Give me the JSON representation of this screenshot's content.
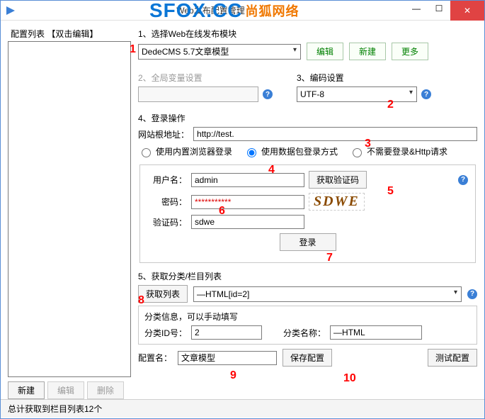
{
  "window": {
    "title": "Web发布配置管理"
  },
  "watermark": {
    "text1": "SFOX.CC",
    "text2": "尚狐网络"
  },
  "left": {
    "list_label": "配置列表 【双击编辑】",
    "new_btn": "新建",
    "edit_btn": "编辑",
    "delete_btn": "删除"
  },
  "sec1": {
    "title": "1、选择Web在线发布模块",
    "module_selected": "DedeCMS 5.7文章模型",
    "edit": "编辑",
    "new": "新建",
    "more": "更多"
  },
  "sec2": {
    "title": "2、全局变量设置"
  },
  "sec3": {
    "title": "3、编码设置",
    "encoding_selected": "UTF-8"
  },
  "sec4": {
    "title": "4、登录操作",
    "root_label": "网站根地址：",
    "root_value": "http://test.",
    "radio1": "使用内置浏览器登录",
    "radio2": "使用数据包登录方式",
    "radio3": "不需要登录&Http请求",
    "user_label": "用户名：",
    "user_value": "admin",
    "pass_label": "密码：",
    "pass_value": "***********",
    "captcha_label": "验证码：",
    "captcha_value": "sdwe",
    "get_captcha_btn": "获取验证码",
    "captcha_img": "SDWE",
    "login_btn": "登录"
  },
  "sec5": {
    "title": "5、获取分类/栏目列表",
    "get_list_btn": "获取列表",
    "list_selected": "—HTML[id=2]",
    "info_label": "分类信息，可以手动填写",
    "id_label": "分类ID号：",
    "id_value": "2",
    "name_label": "分类名称：",
    "name_value": "—HTML"
  },
  "bottom": {
    "config_name_label": "配置名：",
    "config_name_value": "文章模型",
    "save_btn": "保存配置",
    "test_btn": "测试配置"
  },
  "status": "总计获取到栏目列表12个",
  "annotations": {
    "a1": "1",
    "a2": "2",
    "a3": "3",
    "a4": "4",
    "a5": "5",
    "a6": "6",
    "a7": "7",
    "a8": "8",
    "a9": "9",
    "a10": "10"
  }
}
